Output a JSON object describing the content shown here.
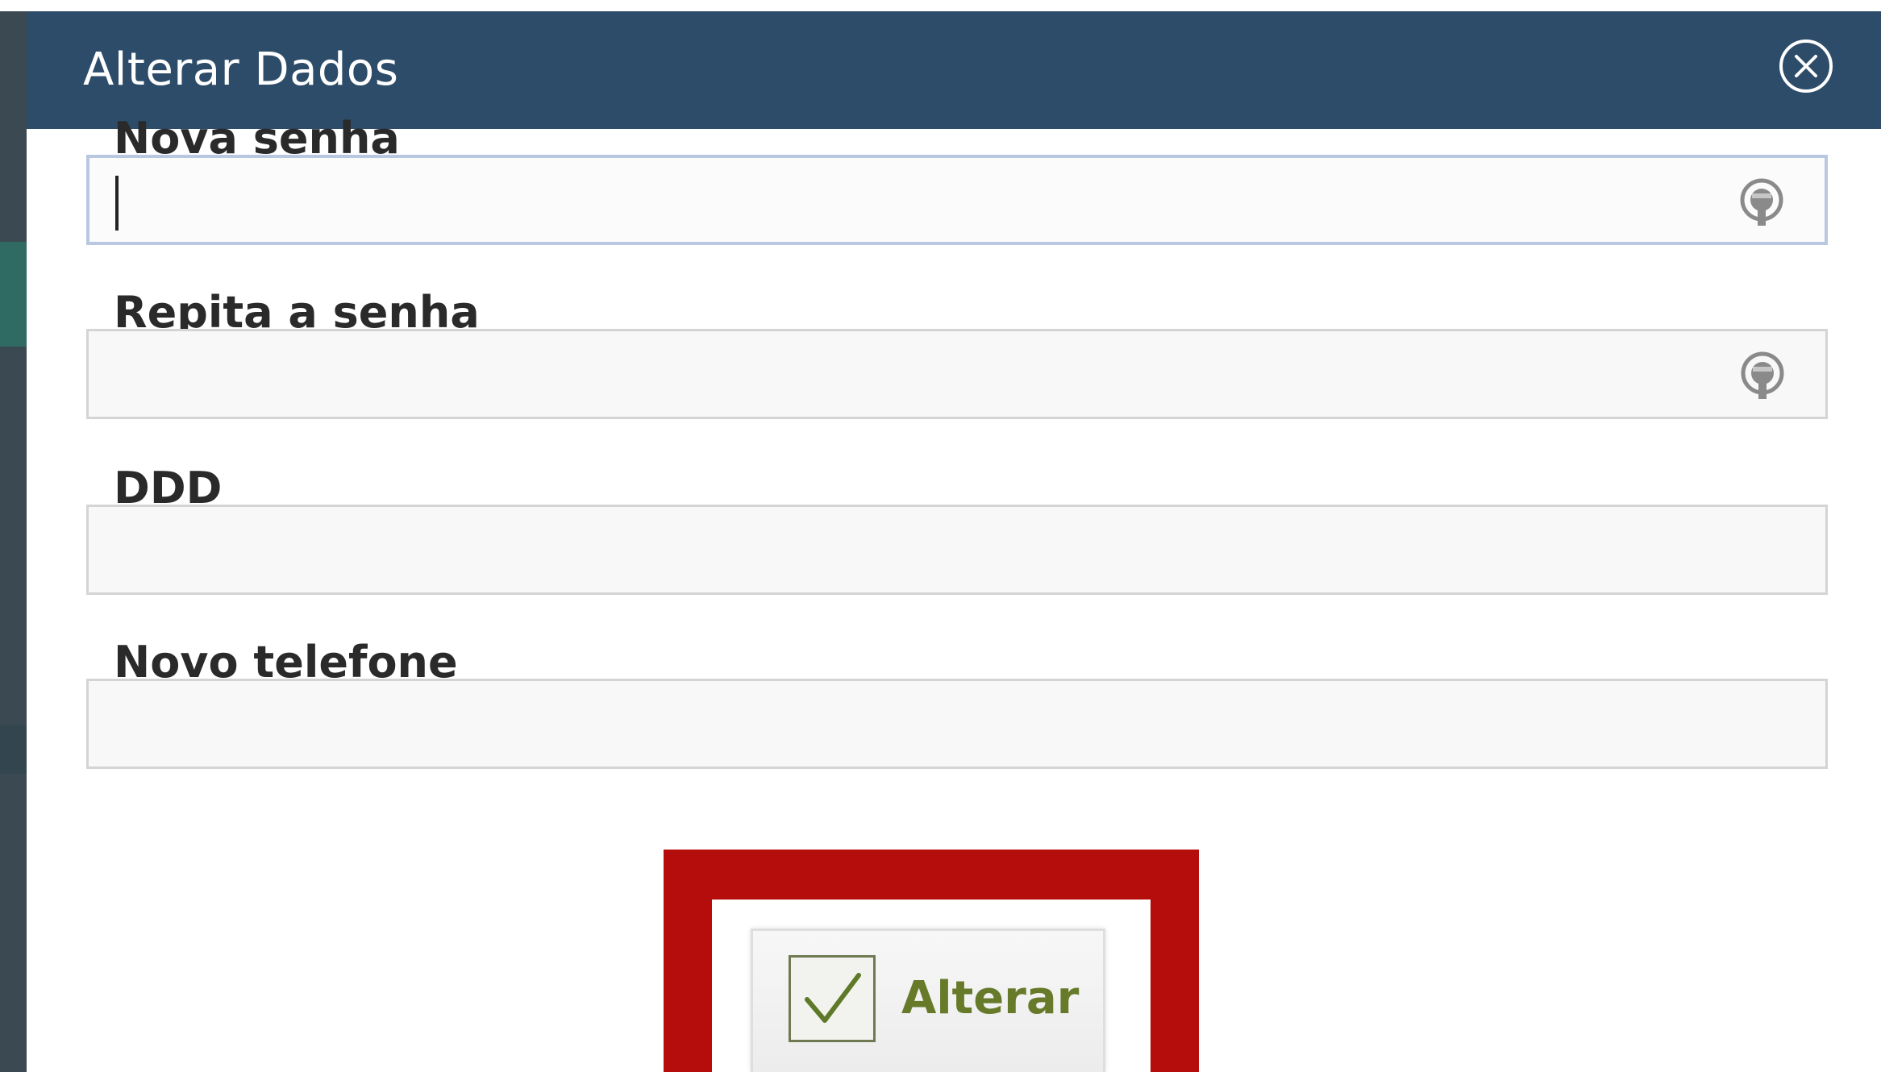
{
  "modal": {
    "title": "Alterar Dados",
    "close_icon": "close-circle-icon"
  },
  "fields": [
    {
      "label": "Nova senha",
      "value": "",
      "type": "password",
      "icon": "key-icon",
      "focused": true
    },
    {
      "label": "Repita a senha",
      "value": "",
      "type": "password",
      "icon": "key-icon",
      "focused": false
    },
    {
      "label": "DDD",
      "value": "",
      "type": "text",
      "focused": false
    },
    {
      "label": "Novo telefone",
      "value": "",
      "type": "text",
      "focused": false
    }
  ],
  "submit": {
    "label": "Alterar",
    "icon": "checkmark-icon"
  },
  "colors": {
    "header": "#2c4c69",
    "highlight": "#b40d0b",
    "button_text": "#667a2a",
    "focus_border": "#b8c8e0"
  }
}
